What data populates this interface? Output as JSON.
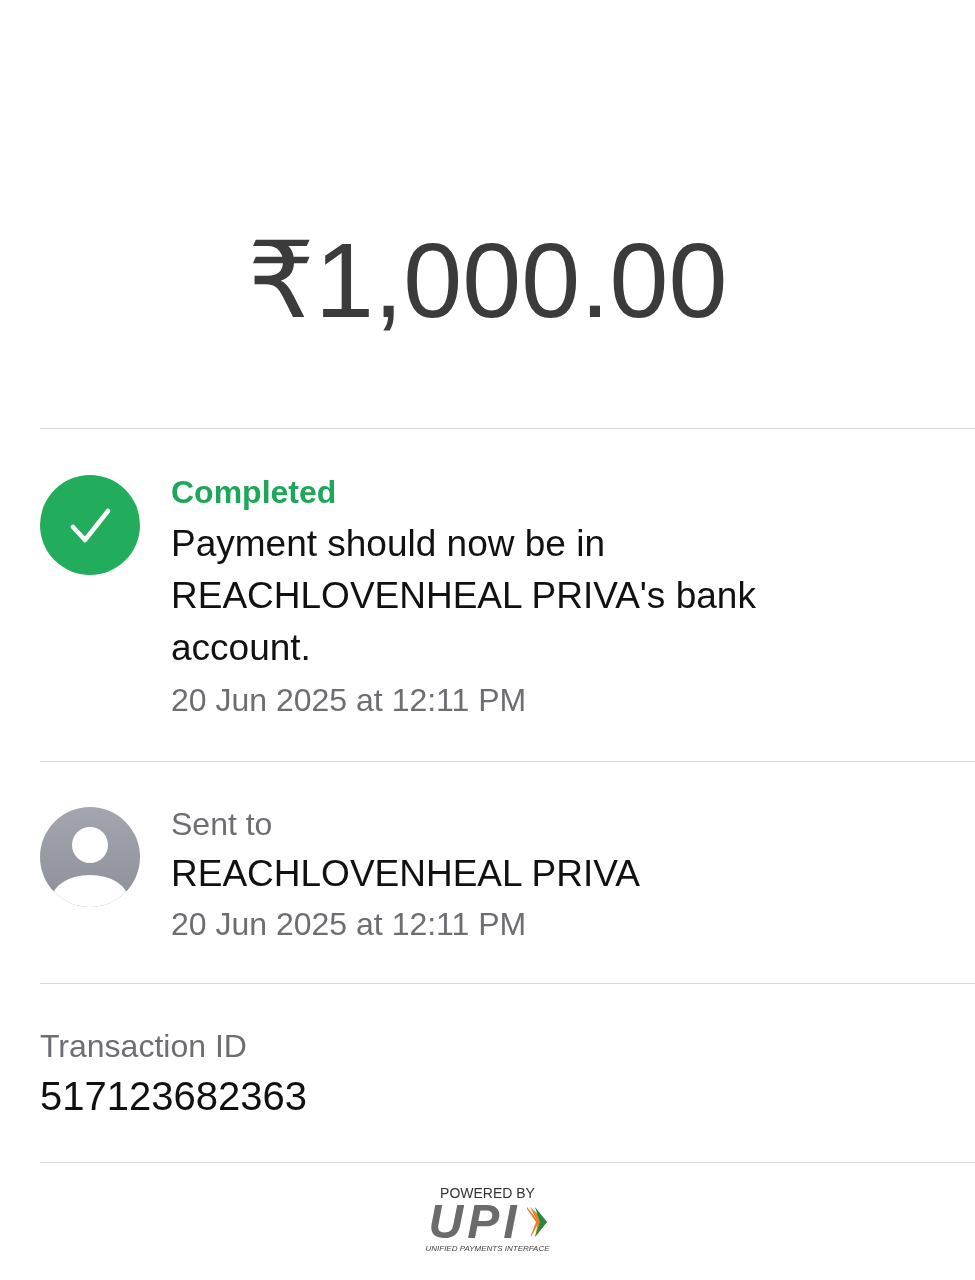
{
  "amount": "₹1,000.00",
  "status": {
    "kind": "completed",
    "label": "Completed",
    "message": "Payment should now be in REACHLOVENHEAL PRIVA's bank account.",
    "timestamp": "20 Jun 2025 at 12:11 PM"
  },
  "recipient": {
    "label": "Sent to",
    "name": "REACHLOVENHEAL PRIVA",
    "timestamp": "20 Jun 2025 at 12:11 PM"
  },
  "transaction": {
    "label": "Transaction ID",
    "value": "517123682363"
  },
  "footer": {
    "powered_by": "POWERED BY",
    "brand": "UPI",
    "tagline": "UNIFIED PAYMENTS INTERFACE"
  }
}
